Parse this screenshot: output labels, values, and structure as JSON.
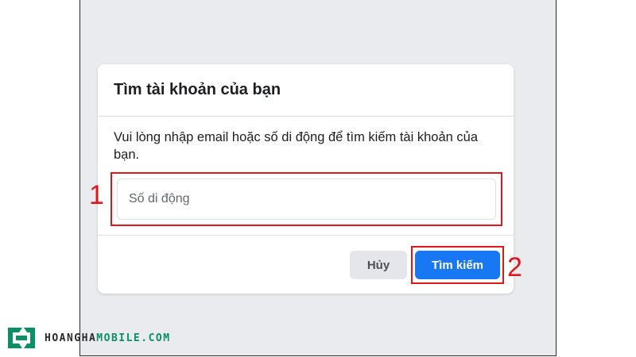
{
  "dialog": {
    "title": "Tìm tài khoản của bạn",
    "instructions": "Vui lòng nhập email hoặc số di động để tìm kiếm tài khoản của bạn.",
    "input_value": "",
    "input_placeholder": "Số di động",
    "cancel_label": "Hủy",
    "search_label": "Tìm kiếm"
  },
  "annotations": {
    "step_1": "1",
    "step_2": "2"
  },
  "watermark": {
    "brand_main": "HOANGHA",
    "brand_suffix": "MOBILE.COM"
  },
  "colors": {
    "primary": "#1877f2",
    "annotation": "#e0161b",
    "brand_accent": "#0a8f67"
  }
}
